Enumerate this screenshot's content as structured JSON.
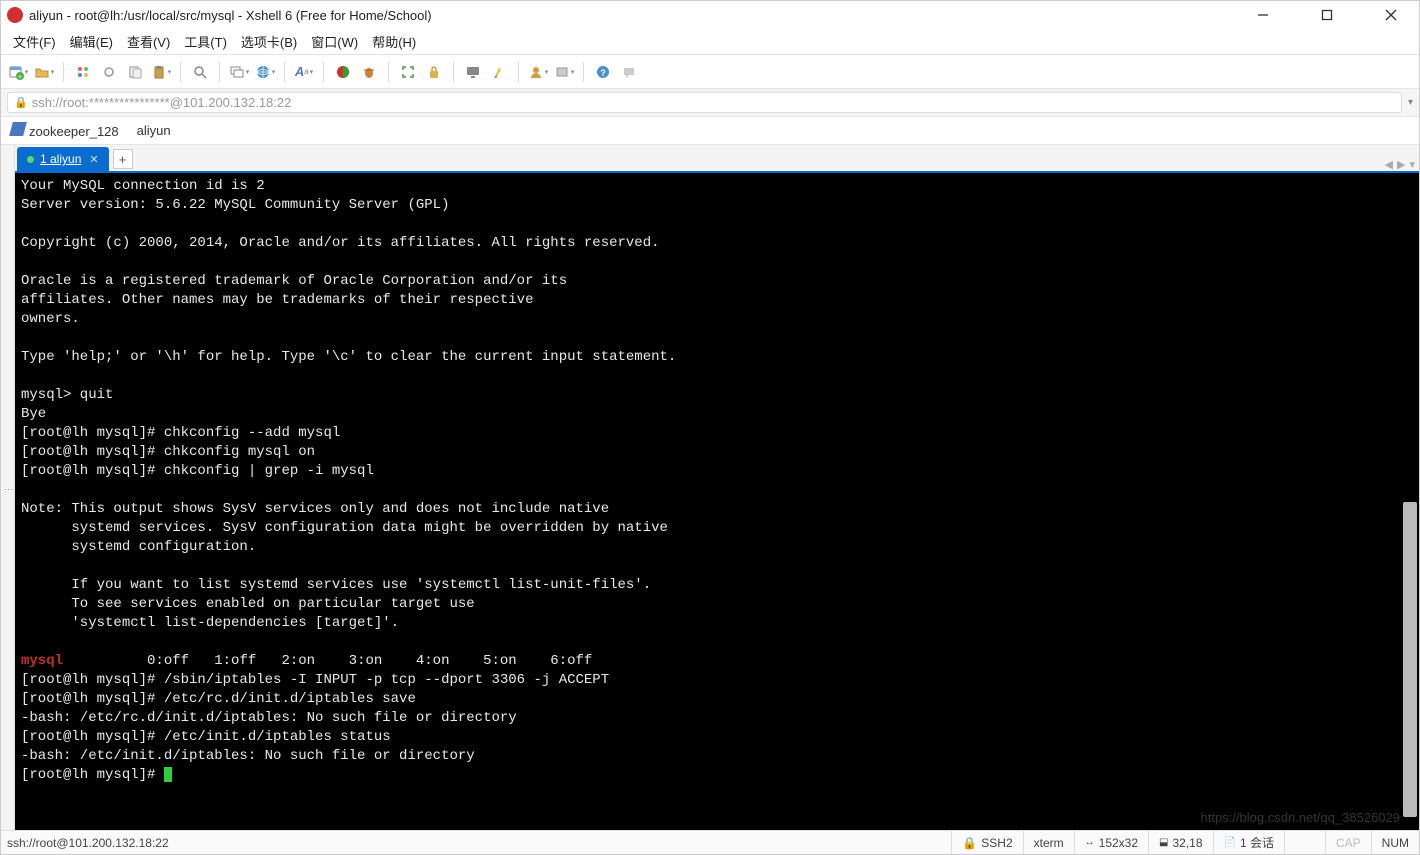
{
  "window": {
    "title": "aliyun - root@lh:/usr/local/src/mysql - Xshell 6 (Free for Home/School)"
  },
  "menus": {
    "file": "文件(F)",
    "edit": "编辑(E)",
    "view": "查看(V)",
    "tools": "工具(T)",
    "tabs": "选项卡(B)",
    "window": "窗口(W)",
    "help": "帮助(H)"
  },
  "address": {
    "url": "ssh://root:****************@101.200.132.18:22"
  },
  "sessions": {
    "zookeeper": "zookeeper_128",
    "aliyun": "aliyun"
  },
  "tab": {
    "label": "1 aliyun"
  },
  "terminal": {
    "lines": [
      "Your MySQL connection id is 2",
      "Server version: 5.6.22 MySQL Community Server (GPL)",
      "",
      "Copyright (c) 2000, 2014, Oracle and/or its affiliates. All rights reserved.",
      "",
      "Oracle is a registered trademark of Oracle Corporation and/or its",
      "affiliates. Other names may be trademarks of their respective",
      "owners.",
      "",
      "Type 'help;' or '\\h' for help. Type '\\c' to clear the current input statement.",
      "",
      "mysql> quit",
      "Bye",
      "[root@lh mysql]# chkconfig --add mysql",
      "[root@lh mysql]# chkconfig mysql on",
      "[root@lh mysql]# chkconfig | grep -i mysql",
      "",
      "Note: This output shows SysV services only and does not include native",
      "      systemd services. SysV configuration data might be overridden by native",
      "      systemd configuration.",
      "",
      "      If you want to list systemd services use 'systemctl list-unit-files'.",
      "      To see services enabled on particular target use",
      "      'systemctl list-dependencies [target]'.",
      ""
    ],
    "mysql_line_name": "mysql",
    "mysql_line_levels": "          0:off   1:off   2:on    3:on    4:on    5:on    6:off",
    "lines2": [
      "[root@lh mysql]# /sbin/iptables -I INPUT -p tcp --dport 3306 -j ACCEPT",
      "[root@lh mysql]# /etc/rc.d/init.d/iptables save",
      "-bash: /etc/rc.d/init.d/iptables: No such file or directory",
      "[root@lh mysql]# /etc/init.d/iptables status",
      "-bash: /etc/init.d/iptables: No such file or directory"
    ],
    "last_prompt": "[root@lh mysql]# "
  },
  "status": {
    "left": "ssh://root@101.200.132.18:22",
    "sub": "",
    "ssh": "SSH2",
    "term": "xterm",
    "size": "152x32",
    "rowcol": "32,18",
    "sessions": "1 会话",
    "cap": "CAP",
    "num": "NUM"
  },
  "icons": {
    "new": "new-session",
    "open": "folder-open",
    "props": "properties",
    "link": "reconnect",
    "copy": "copy",
    "paste": "paste",
    "search": "search",
    "sessions": "sessions",
    "globe": "globe",
    "font": "font",
    "color": "color-scheme",
    "fullscreen": "fullscreen",
    "lock": "lock",
    "desk": "desktop",
    "hl": "highlight",
    "user": "user",
    "more": "more",
    "help": "help",
    "chat": "chat"
  }
}
